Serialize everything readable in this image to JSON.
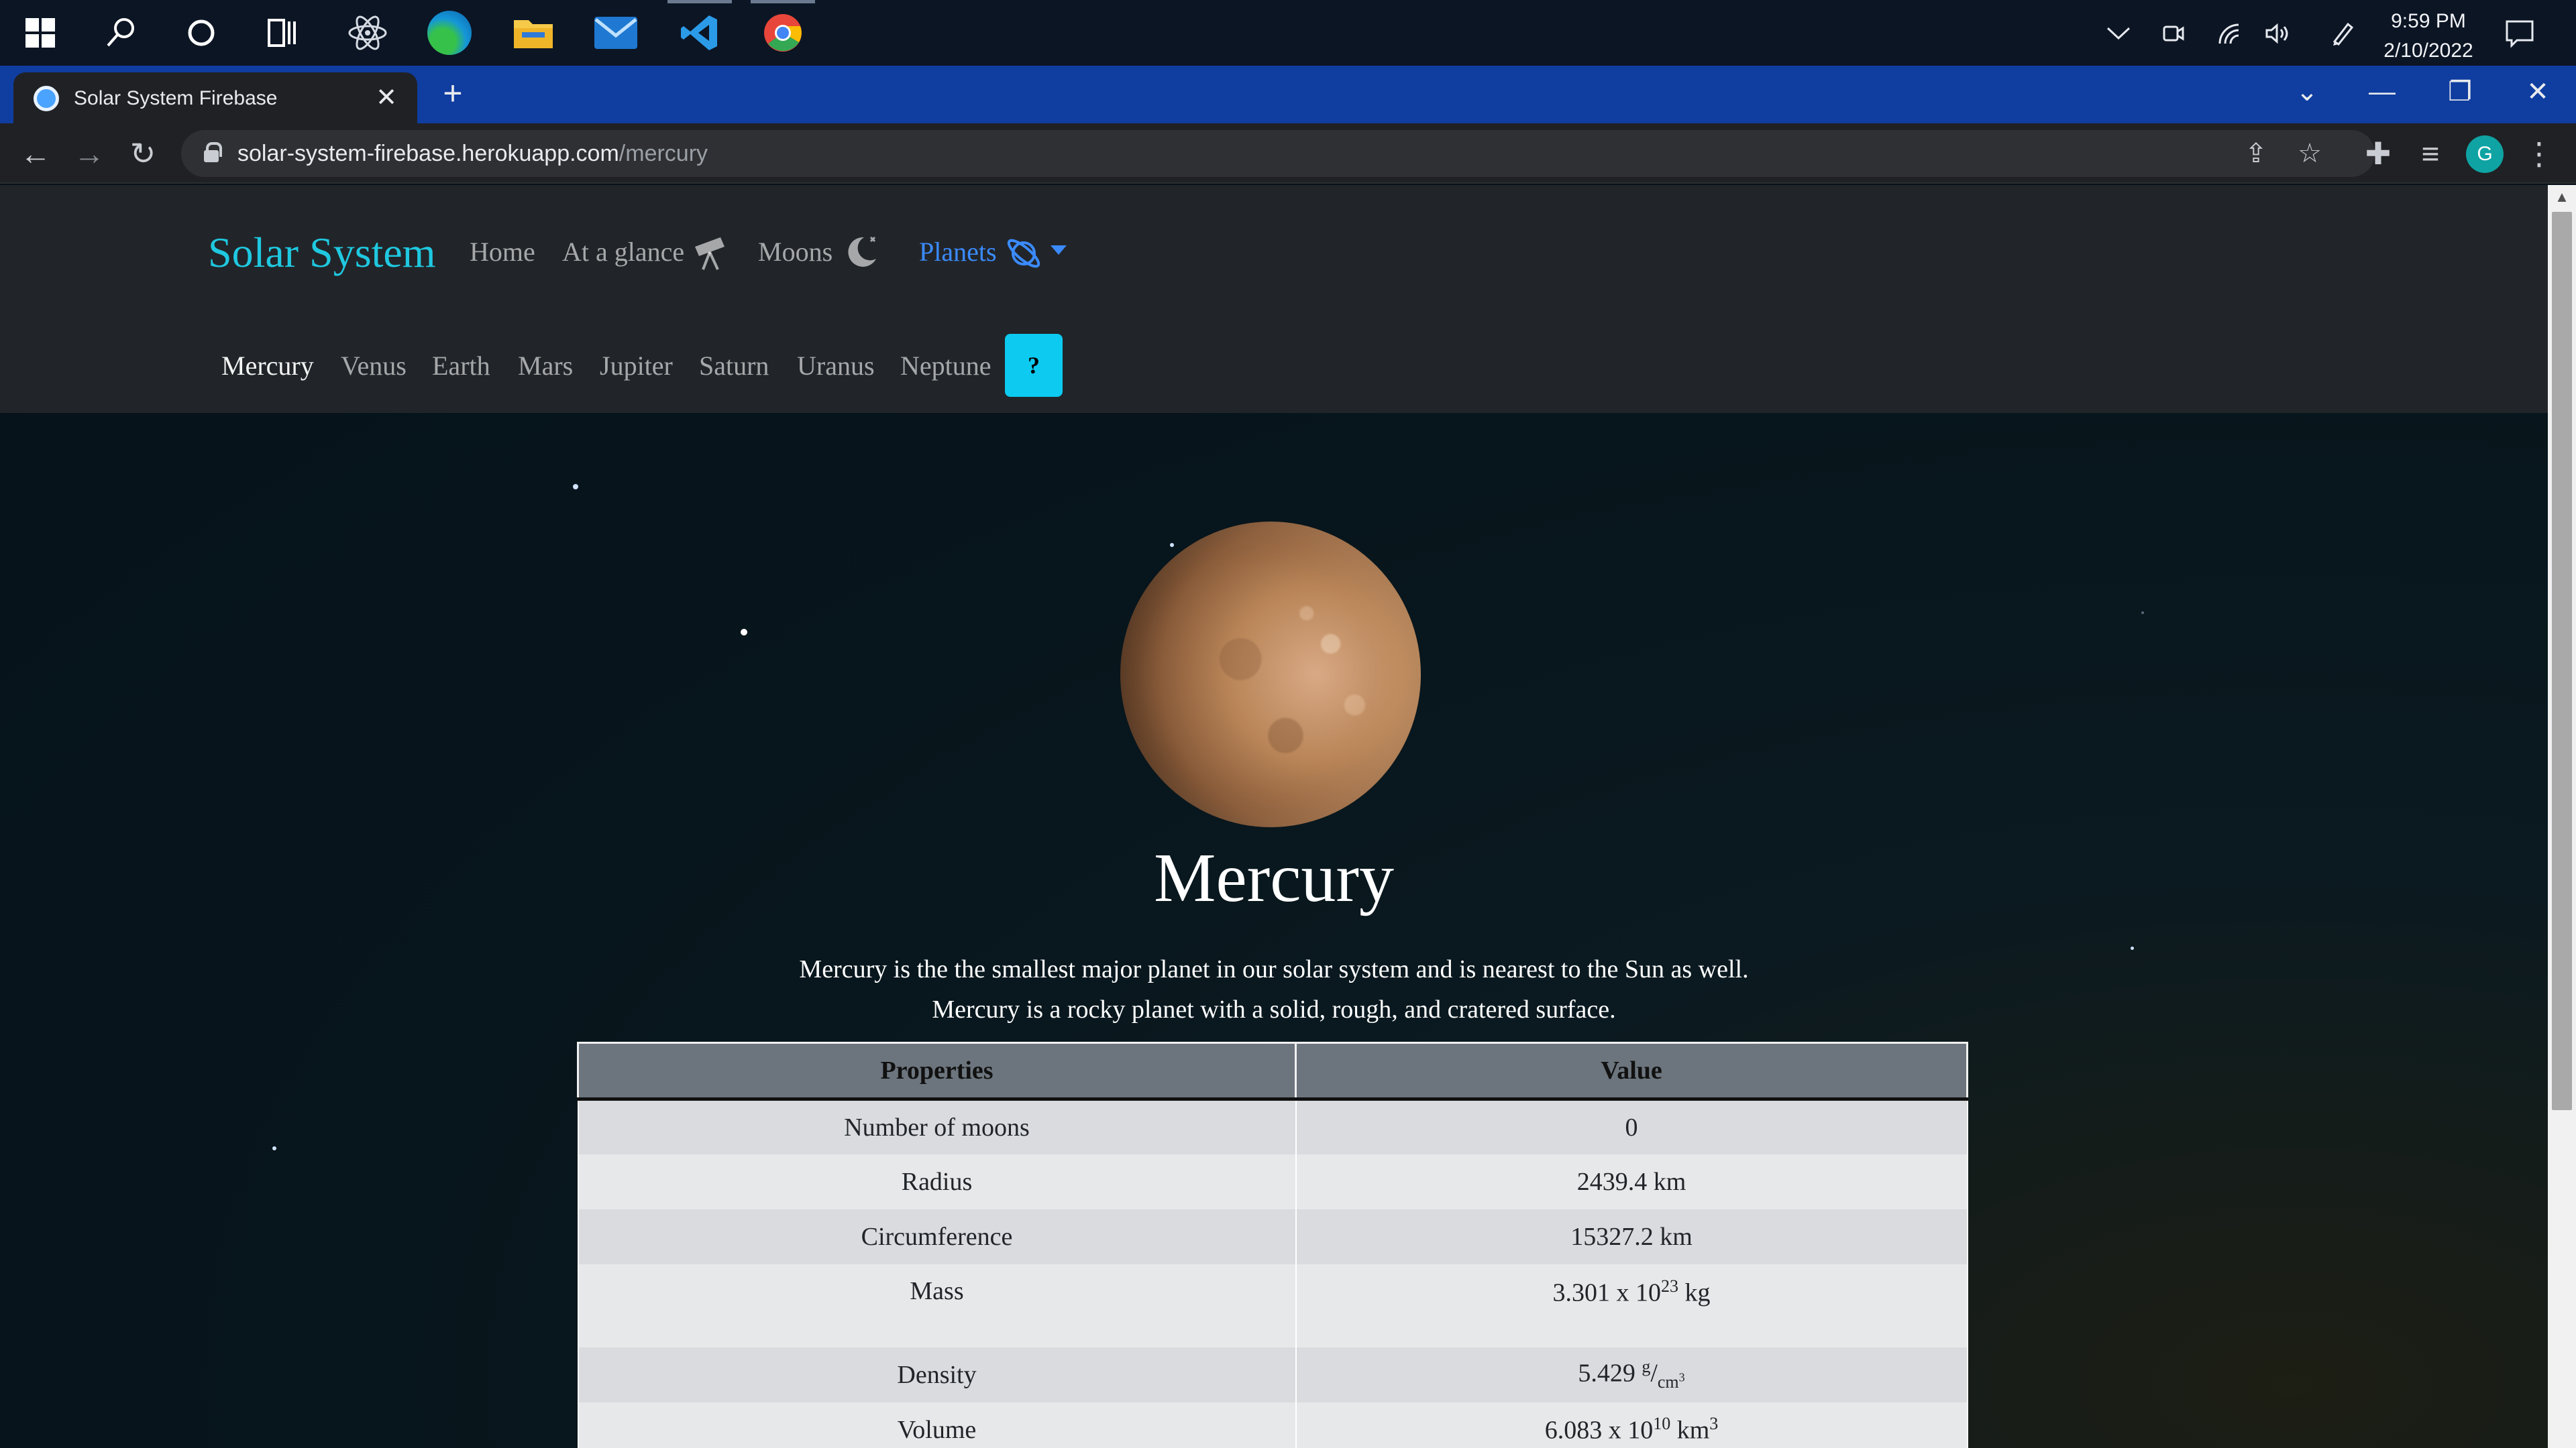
{
  "taskbar": {
    "apps": [
      {
        "name": "start",
        "icon": "windows-icon"
      },
      {
        "name": "search",
        "icon": "search-icon"
      },
      {
        "name": "cortana",
        "icon": "cortana-icon"
      },
      {
        "name": "task-view",
        "icon": "task-view-icon"
      },
      {
        "name": "electron",
        "icon": "atom-icon"
      },
      {
        "name": "edge",
        "icon": "edge-icon"
      },
      {
        "name": "file-explorer",
        "icon": "folder-icon"
      },
      {
        "name": "mail",
        "icon": "mail-icon"
      },
      {
        "name": "vscode",
        "icon": "vscode-icon"
      },
      {
        "name": "chrome",
        "icon": "chrome-icon"
      }
    ],
    "time": "9:59 PM",
    "date": "2/10/2022"
  },
  "browser": {
    "tab_title": "Solar System Firebase",
    "url_host": "solar-system-firebase.herokuapp.com",
    "url_path": "/mercury",
    "profile_initial": "G"
  },
  "nav": {
    "brand": "Solar System",
    "links": [
      "Home",
      "At a glance",
      "Moons",
      "Planets"
    ],
    "planets": [
      "Mercury",
      "Venus",
      "Earth",
      "Mars",
      "Jupiter",
      "Saturn",
      "Uranus",
      "Neptune"
    ],
    "help": "?"
  },
  "planet": {
    "name": "Mercury",
    "description_1": "Mercury is the the smallest major planet in our solar system and is nearest to the Sun as well.",
    "description_2": "Mercury is a rocky planet with a solid, rough, and cratered surface."
  },
  "table": {
    "headers": [
      "Properties",
      "Value"
    ],
    "rows": [
      {
        "property": "Number of moons",
        "value": "0"
      },
      {
        "property": "Radius",
        "value": "2439.4 km"
      },
      {
        "property": "Circumference",
        "value": "15327.2 km"
      },
      {
        "property": "Mass",
        "value_base": "3.301 x 10",
        "value_exp": "23",
        "value_unit": " kg"
      },
      {
        "property": "Density",
        "value_base": "5.429 ",
        "value_num": "g",
        "value_den": "cm",
        "value_den_exp": "3"
      },
      {
        "property": "Volume",
        "value_base": "6.083 x 10",
        "value_exp": "10",
        "value_unit": " km",
        "value_unit_exp": "3"
      }
    ]
  },
  "colors": {
    "brand": "#1fc8e0",
    "active_nav": "#3b8bff",
    "help_button": "#0dcaf0",
    "navbar_bg": "#212529",
    "tabstrip_bg": "#0f3da0"
  }
}
